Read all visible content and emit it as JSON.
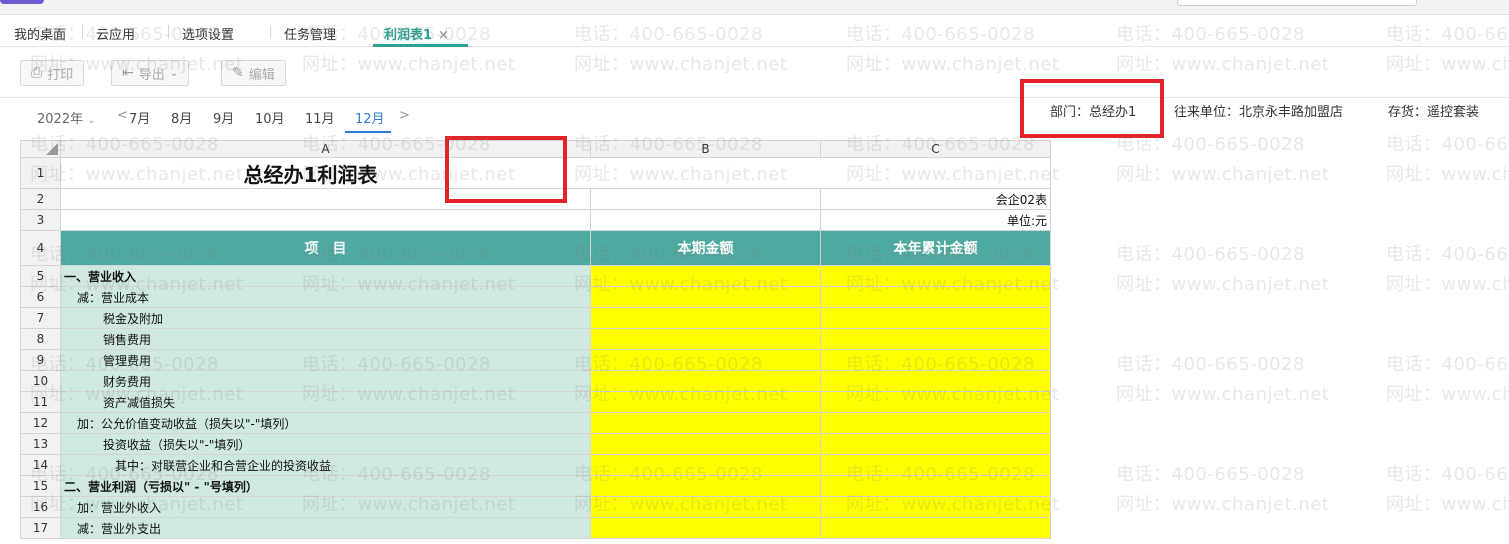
{
  "tabs": [
    "我的桌面",
    "云应用",
    "选项设置",
    "任务管理",
    "利润表1"
  ],
  "tab_close": "×",
  "toolbar": {
    "print": "打印",
    "export": "导出",
    "edit": "编辑"
  },
  "period": {
    "year": "2022年",
    "months": [
      "7月",
      "8月",
      "9月",
      "10月",
      "11月",
      "12月"
    ],
    "active_month": "12月",
    "prev": "<",
    "next": ">"
  },
  "filters": {
    "department": "部门：总经办1",
    "partner": "往来单位：北京永丰路加盟店",
    "inventory": "存货：遥控套装"
  },
  "sheet": {
    "columns": [
      "A",
      "B",
      "C"
    ],
    "title": "总经办1利润表",
    "form_no": "会企02表",
    "unit": "单位:元",
    "headers": [
      "项　目",
      "本期金额",
      "本年累计金额"
    ],
    "rows": [
      {
        "num": "5",
        "label": "一、营业收入"
      },
      {
        "num": "6",
        "label": "减：营业成本"
      },
      {
        "num": "7",
        "label": "税金及附加"
      },
      {
        "num": "8",
        "label": "销售费用"
      },
      {
        "num": "9",
        "label": "管理费用"
      },
      {
        "num": "10",
        "label": "财务费用"
      },
      {
        "num": "11",
        "label": "资产减值损失"
      },
      {
        "num": "12",
        "label": "加：公允价值变动收益（损失以\"-\"填列）"
      },
      {
        "num": "13",
        "label": "投资收益（损失以\"-\"填列）"
      },
      {
        "num": "14",
        "label": "其中：对联营企业和合营企业的投资收益"
      },
      {
        "num": "15",
        "label": "二、营业利润（亏损以\" - \"号填列）"
      },
      {
        "num": "16",
        "label": "加：营业外收入"
      },
      {
        "num": "17",
        "label": "减：营业外支出"
      }
    ]
  },
  "watermark": {
    "phone": "电话：400-665-0028",
    "site": "网址：www.chanjet.net"
  },
  "colors": {
    "accent": "#2fa08f",
    "header": "#4ea9a0",
    "item_bg": "#cfe8e0",
    "value_bg": "#ffff00",
    "highlight": "#e0242a"
  }
}
